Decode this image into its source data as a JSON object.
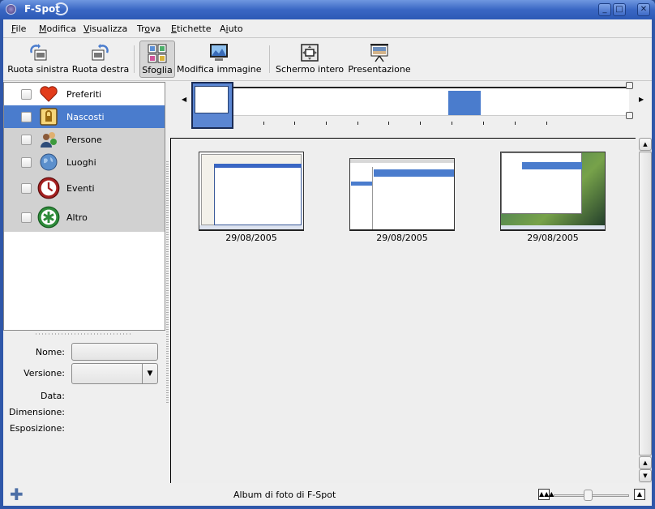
{
  "window": {
    "title": "F-Spot",
    "controls": {
      "minimize": "_",
      "maximize": "□",
      "close": "✕"
    }
  },
  "menubar": {
    "items": [
      {
        "label": "File",
        "mnemonic": "F"
      },
      {
        "label": "Modifica",
        "mnemonic": "M"
      },
      {
        "label": "Visualizza",
        "mnemonic": "V"
      },
      {
        "label": "Trova",
        "mnemonic": "o"
      },
      {
        "label": "Etichette",
        "mnemonic": "E"
      },
      {
        "label": "Aiuto",
        "mnemonic": "i"
      }
    ]
  },
  "toolbar": {
    "rotate_left": "Ruota sinistra",
    "rotate_right": "Ruota destra",
    "browse": "Sfoglia",
    "edit_image": "Modifica immagine",
    "fullscreen": "Schermo intero",
    "slideshow": "Presentazione"
  },
  "tags": [
    {
      "label": "Preferiti",
      "icon": "heart-icon",
      "checked": false,
      "selected": false
    },
    {
      "label": "Nascosti",
      "icon": "lock-icon",
      "checked": false,
      "selected": true
    },
    {
      "label": "Persone",
      "icon": "people-icon",
      "checked": false,
      "selected": false
    },
    {
      "label": "Luoghi",
      "icon": "globe-icon",
      "checked": false,
      "selected": false
    },
    {
      "label": "Eventi",
      "icon": "clock-icon",
      "checked": false,
      "selected": false
    },
    {
      "label": "Altro",
      "icon": "asterisk-icon",
      "checked": false,
      "selected": false
    }
  ],
  "info": {
    "name_label": "Nome:",
    "name_value": "",
    "version_label": "Versione:",
    "version_value": "",
    "date_label": "Data:",
    "size_label": "Dimensione:",
    "exposure_label": "Esposizione:"
  },
  "photos": [
    {
      "date": "29/08/2005",
      "type": "desktop-screenshot-dialog"
    },
    {
      "date": "29/08/2005",
      "type": "app-window-screenshot"
    },
    {
      "date": "29/08/2005",
      "type": "desktop-screenshot-wallpaper"
    }
  ],
  "statusbar": {
    "text": "Album di foto di F-Spot",
    "zoom_fraction": 0.45
  },
  "colors": {
    "selection": "#4a7ccd",
    "titlebar": "#3a67c4"
  }
}
